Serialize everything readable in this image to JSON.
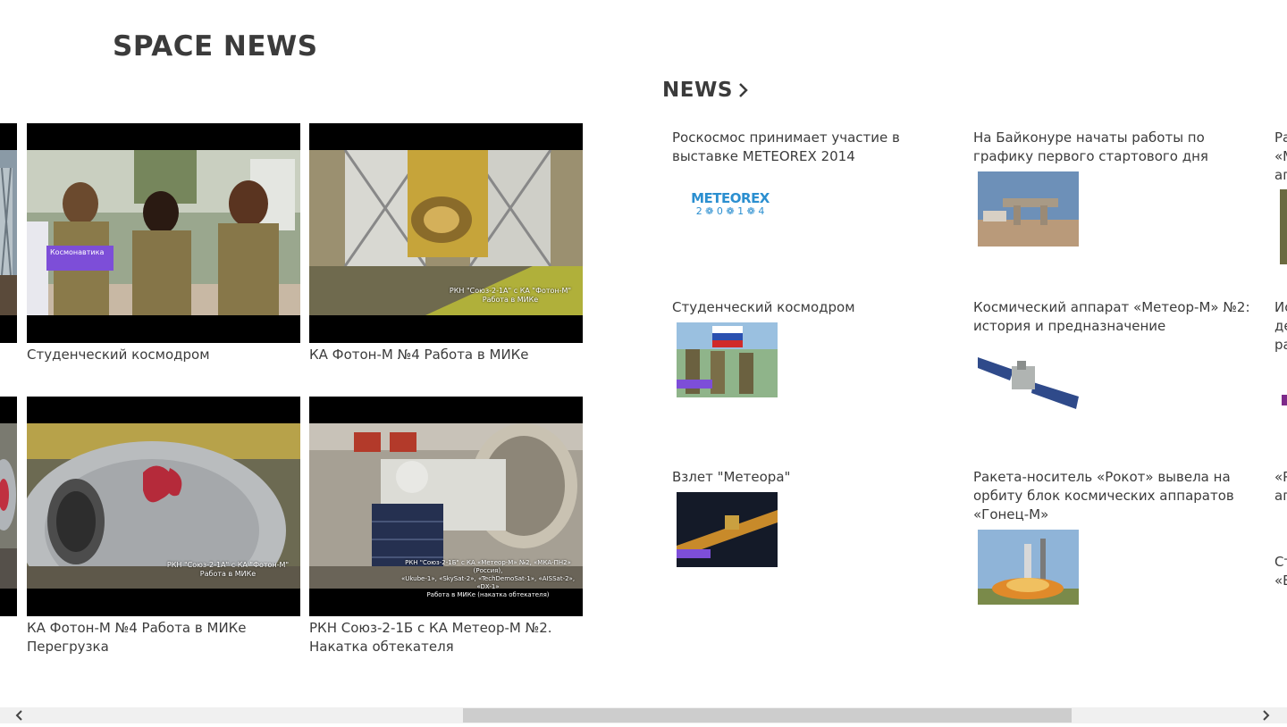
{
  "app": {
    "title": "SPACE NEWS"
  },
  "videos": {
    "items": [
      {
        "caption": "Студенческий космодром",
        "overlay": "Космонавтика"
      },
      {
        "caption": "КА Фотон-М №4 Работа в МИКе",
        "overlay": "РКН \"Союз-2-1А\" с КА \"Фотон-М\"\nРабота в МИКе"
      },
      {
        "caption": "КА Фотон-М №4 Работа в МИКе Перегрузка",
        "overlay": "РКН \"Союз-2-1А\" с КА \"Фотон-М\"\nРабота в МИКе"
      },
      {
        "caption": "РКН Союз-2-1Б с КА Метеор-М №2. Накатка обтекателя",
        "overlay": "РКН \"Союз-2-1Б\" с КА «Метеор-М» №2, «МКА-ПН2» (Россия),\n«Ukube-1», «SkySat-2», «TechDemoSat-1», «AISSat-2», «DX-1»\nРабота в МИКе (накатка обтекателя)"
      }
    ]
  },
  "news": {
    "header": "NEWS",
    "items": [
      {
        "title": "Роскосмос принимает участие в выставке METEOREX 2014",
        "logo_top": "METEOREX",
        "logo_bottom": "2 ❁ 0 ❁ 1 ❁ 4"
      },
      {
        "title": "На Байконуре начаты работы по графику первого стартового дня"
      },
      {
        "title": "Студенческий космодром"
      },
      {
        "title": "Космический аппарат «Метеор-М» №2: история и предназначение"
      },
      {
        "title": "Взлет \"Метеора\""
      },
      {
        "title": "Ракета-носитель «Рокот» вывела на орбиту блок космических аппаратов «Гонец-М»"
      }
    ],
    "cut_column": [
      [
        "Ра",
        "«М",
        "ап"
      ],
      [
        "Ис",
        "де",
        "ра"
      ],
      [
        "«Р",
        "ап"
      ],
      [
        "Ст",
        "«Б"
      ]
    ]
  },
  "colors": {
    "accent": "#7d4ed8",
    "scrollbar_track": "#f0f0f0",
    "scrollbar_thumb": "#cdcdcd"
  },
  "icons": {
    "header_chevron": "chevron-right-icon",
    "scroll_left": "arrow-left-icon",
    "scroll_right": "arrow-right-icon"
  }
}
